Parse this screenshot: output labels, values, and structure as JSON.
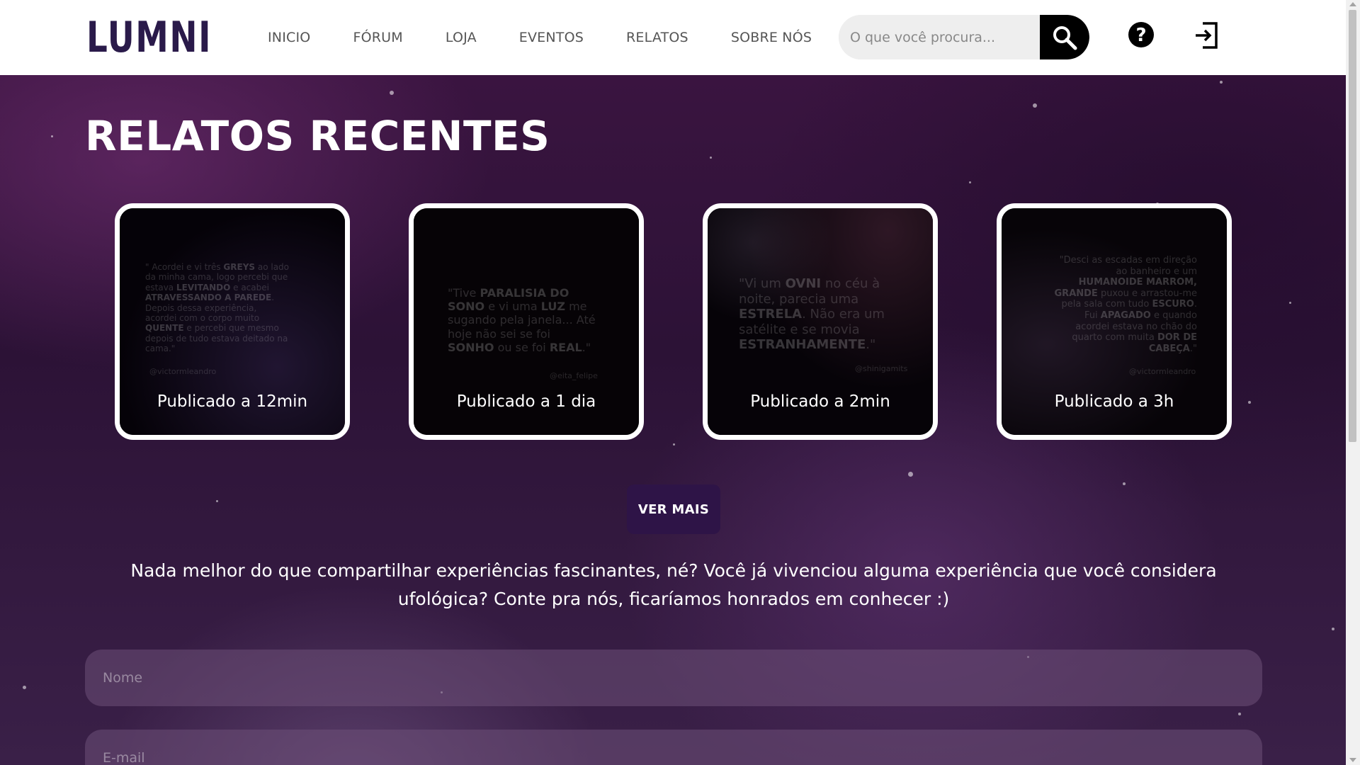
{
  "header": {
    "logo_text": "LUMNI",
    "nav": [
      "INICIO",
      "FÓRUM",
      "LOJA",
      "EVENTOS",
      "RELATOS",
      "SOBRE NÓS"
    ],
    "search": {
      "placeholder": "O que você procura..."
    },
    "icons": {
      "search": "search-icon",
      "help": "help-icon",
      "login": "login-icon"
    }
  },
  "main": {
    "title": "RELATOS RECENTES",
    "cards": [
      {
        "label": "Publicado a 12min",
        "quote_html": "\" Acordei e vi três <b>GREYS</b> ao lado da minha cama, logo percebi que estava <b>LEVITANDO</b> e acabei <b>ATRAVESSANDO A PAREDE</b>. Depois dessa experiência, acordei com o corpo muito <b>QUENTE</b> e percebi que mesmo depois de tudo estava deitado na cama.\"",
        "author": "@victormleandro"
      },
      {
        "label": "Publicado a 1 dia",
        "quote_html": "\"Tive <b>PARALISIA DO SONO</b> e vi uma <b>LUZ</b> me sugando pela janela... Até hoje não sei se foi <b>SONHO</b> ou se foi <b>REAL</b>.\"",
        "author": "@eita_felipe"
      },
      {
        "label": "Publicado a 2min",
        "quote_html": "\"Vi um <b>OVNI</b> no céu à noite, parecia uma <b>ESTRELA</b>. Não era um satélite e se movia <b>ESTRANHAMENTE</b>.\"",
        "author": "@shinigamits"
      },
      {
        "label": "Publicado a 3h",
        "quote_html": "\"Desci as escadas em direção ao banheiro e um <b>HUMANOIDE MARROM, GRANDE</b> puxou e arrastou-me pela sala com tudo <b>ESCURO</b>. Fui <b>APAGADO</b> e quando acordei estava no chão do quarto com muita <b>DOR DE CABEÇA</b>.\"",
        "author": "@victormleandro"
      }
    ],
    "ver_mais": "VER MAIS",
    "intro": "Nada melhor do que compartilhar experiências fascinantes, né? Você já vivenciou alguma experiência que você considera ufológica? Conte pra nós, ficaríamos honrados em conhecer :)",
    "form": {
      "name_placeholder": "Nome",
      "email_placeholder": "E-mail"
    }
  },
  "colors": {
    "header_bg": "#ffffff",
    "nav_text": "#555555",
    "bg_dark": "#2c1236",
    "button_bg": "#2e1447",
    "card_border": "#ffffff"
  }
}
